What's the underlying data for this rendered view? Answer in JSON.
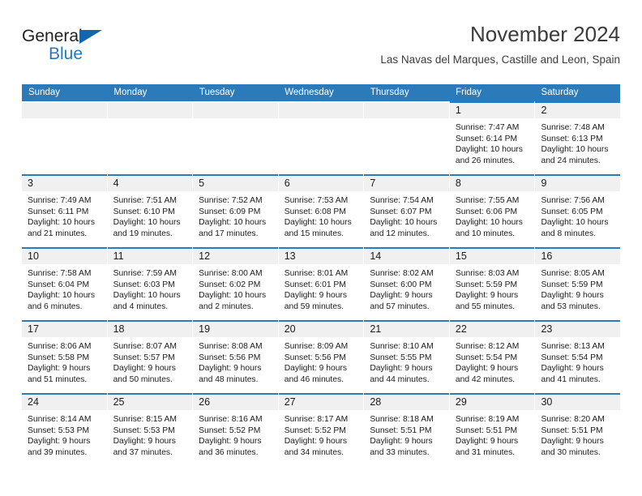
{
  "brand": {
    "word_one": "General",
    "word_two": "Blue",
    "accent_color": "#1f7bc1",
    "triangle_color": "#1266ad"
  },
  "header": {
    "title": "November 2024",
    "subtitle": "Las Navas del Marques, Castille and Leon, Spain"
  },
  "calendar": {
    "header_bg": "#2b7ab9",
    "daynum_bg": "#f0f0f0",
    "weekdays": [
      "Sunday",
      "Monday",
      "Tuesday",
      "Wednesday",
      "Thursday",
      "Friday",
      "Saturday"
    ],
    "weeks": [
      [
        {
          "day": "",
          "empty": true
        },
        {
          "day": "",
          "empty": true
        },
        {
          "day": "",
          "empty": true
        },
        {
          "day": "",
          "empty": true
        },
        {
          "day": "",
          "empty": true
        },
        {
          "day": "1",
          "sunrise": "Sunrise: 7:47 AM",
          "sunset": "Sunset: 6:14 PM",
          "daylight": "Daylight: 10 hours and 26 minutes."
        },
        {
          "day": "2",
          "sunrise": "Sunrise: 7:48 AM",
          "sunset": "Sunset: 6:13 PM",
          "daylight": "Daylight: 10 hours and 24 minutes."
        }
      ],
      [
        {
          "day": "3",
          "sunrise": "Sunrise: 7:49 AM",
          "sunset": "Sunset: 6:11 PM",
          "daylight": "Daylight: 10 hours and 21 minutes."
        },
        {
          "day": "4",
          "sunrise": "Sunrise: 7:51 AM",
          "sunset": "Sunset: 6:10 PM",
          "daylight": "Daylight: 10 hours and 19 minutes."
        },
        {
          "day": "5",
          "sunrise": "Sunrise: 7:52 AM",
          "sunset": "Sunset: 6:09 PM",
          "daylight": "Daylight: 10 hours and 17 minutes."
        },
        {
          "day": "6",
          "sunrise": "Sunrise: 7:53 AM",
          "sunset": "Sunset: 6:08 PM",
          "daylight": "Daylight: 10 hours and 15 minutes."
        },
        {
          "day": "7",
          "sunrise": "Sunrise: 7:54 AM",
          "sunset": "Sunset: 6:07 PM",
          "daylight": "Daylight: 10 hours and 12 minutes."
        },
        {
          "day": "8",
          "sunrise": "Sunrise: 7:55 AM",
          "sunset": "Sunset: 6:06 PM",
          "daylight": "Daylight: 10 hours and 10 minutes."
        },
        {
          "day": "9",
          "sunrise": "Sunrise: 7:56 AM",
          "sunset": "Sunset: 6:05 PM",
          "daylight": "Daylight: 10 hours and 8 minutes."
        }
      ],
      [
        {
          "day": "10",
          "sunrise": "Sunrise: 7:58 AM",
          "sunset": "Sunset: 6:04 PM",
          "daylight": "Daylight: 10 hours and 6 minutes."
        },
        {
          "day": "11",
          "sunrise": "Sunrise: 7:59 AM",
          "sunset": "Sunset: 6:03 PM",
          "daylight": "Daylight: 10 hours and 4 minutes."
        },
        {
          "day": "12",
          "sunrise": "Sunrise: 8:00 AM",
          "sunset": "Sunset: 6:02 PM",
          "daylight": "Daylight: 10 hours and 2 minutes."
        },
        {
          "day": "13",
          "sunrise": "Sunrise: 8:01 AM",
          "sunset": "Sunset: 6:01 PM",
          "daylight": "Daylight: 9 hours and 59 minutes."
        },
        {
          "day": "14",
          "sunrise": "Sunrise: 8:02 AM",
          "sunset": "Sunset: 6:00 PM",
          "daylight": "Daylight: 9 hours and 57 minutes."
        },
        {
          "day": "15",
          "sunrise": "Sunrise: 8:03 AM",
          "sunset": "Sunset: 5:59 PM",
          "daylight": "Daylight: 9 hours and 55 minutes."
        },
        {
          "day": "16",
          "sunrise": "Sunrise: 8:05 AM",
          "sunset": "Sunset: 5:59 PM",
          "daylight": "Daylight: 9 hours and 53 minutes."
        }
      ],
      [
        {
          "day": "17",
          "sunrise": "Sunrise: 8:06 AM",
          "sunset": "Sunset: 5:58 PM",
          "daylight": "Daylight: 9 hours and 51 minutes."
        },
        {
          "day": "18",
          "sunrise": "Sunrise: 8:07 AM",
          "sunset": "Sunset: 5:57 PM",
          "daylight": "Daylight: 9 hours and 50 minutes."
        },
        {
          "day": "19",
          "sunrise": "Sunrise: 8:08 AM",
          "sunset": "Sunset: 5:56 PM",
          "daylight": "Daylight: 9 hours and 48 minutes."
        },
        {
          "day": "20",
          "sunrise": "Sunrise: 8:09 AM",
          "sunset": "Sunset: 5:56 PM",
          "daylight": "Daylight: 9 hours and 46 minutes."
        },
        {
          "day": "21",
          "sunrise": "Sunrise: 8:10 AM",
          "sunset": "Sunset: 5:55 PM",
          "daylight": "Daylight: 9 hours and 44 minutes."
        },
        {
          "day": "22",
          "sunrise": "Sunrise: 8:12 AM",
          "sunset": "Sunset: 5:54 PM",
          "daylight": "Daylight: 9 hours and 42 minutes."
        },
        {
          "day": "23",
          "sunrise": "Sunrise: 8:13 AM",
          "sunset": "Sunset: 5:54 PM",
          "daylight": "Daylight: 9 hours and 41 minutes."
        }
      ],
      [
        {
          "day": "24",
          "sunrise": "Sunrise: 8:14 AM",
          "sunset": "Sunset: 5:53 PM",
          "daylight": "Daylight: 9 hours and 39 minutes."
        },
        {
          "day": "25",
          "sunrise": "Sunrise: 8:15 AM",
          "sunset": "Sunset: 5:53 PM",
          "daylight": "Daylight: 9 hours and 37 minutes."
        },
        {
          "day": "26",
          "sunrise": "Sunrise: 8:16 AM",
          "sunset": "Sunset: 5:52 PM",
          "daylight": "Daylight: 9 hours and 36 minutes."
        },
        {
          "day": "27",
          "sunrise": "Sunrise: 8:17 AM",
          "sunset": "Sunset: 5:52 PM",
          "daylight": "Daylight: 9 hours and 34 minutes."
        },
        {
          "day": "28",
          "sunrise": "Sunrise: 8:18 AM",
          "sunset": "Sunset: 5:51 PM",
          "daylight": "Daylight: 9 hours and 33 minutes."
        },
        {
          "day": "29",
          "sunrise": "Sunrise: 8:19 AM",
          "sunset": "Sunset: 5:51 PM",
          "daylight": "Daylight: 9 hours and 31 minutes."
        },
        {
          "day": "30",
          "sunrise": "Sunrise: 8:20 AM",
          "sunset": "Sunset: 5:51 PM",
          "daylight": "Daylight: 9 hours and 30 minutes."
        }
      ]
    ]
  }
}
